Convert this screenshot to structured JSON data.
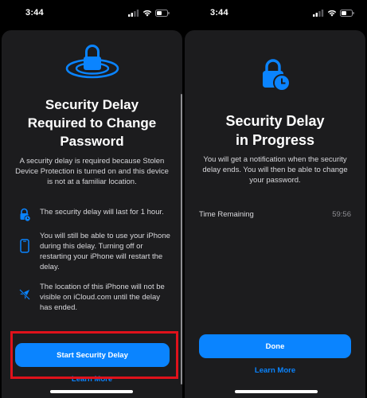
{
  "colors": {
    "accent": "#0a84ff",
    "sheet_background": "#1c1c1e",
    "highlight_border": "#e0121b"
  },
  "left_screen": {
    "status_time": "3:44",
    "hero_icon": "lock-with-rings-icon",
    "title_line1": "Security Delay",
    "title_line2": "Required to Change",
    "title_line3": "Password",
    "description": "A security delay is required because Stolen Device Protection is turned on and this device is not at a familiar location.",
    "bullets": [
      {
        "icon": "lock-clock-icon",
        "text": "The security delay will last for 1 hour."
      },
      {
        "icon": "iphone-icon",
        "text": "You will still be able to use your iPhone during this delay. Turning off or restarting your iPhone will restart the delay."
      },
      {
        "icon": "location-off-icon",
        "text": "The location of this iPhone will not be visible on iCloud.com until the delay has ended."
      }
    ],
    "primary_button": "Start Security Delay",
    "link": "Learn More"
  },
  "right_screen": {
    "status_time": "3:44",
    "hero_icon": "lock-clock-icon",
    "title_line1": "Security Delay",
    "title_line2": "in Progress",
    "description": "You will get a notification when the security delay ends. You will then be able to change your password.",
    "row_label": "Time Remaining",
    "row_value": "59:56",
    "primary_button": "Done",
    "link": "Learn More"
  }
}
